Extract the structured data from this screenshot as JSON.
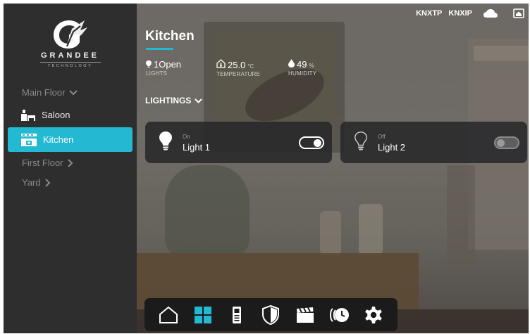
{
  "app": {
    "brand": "GRANDEE",
    "brand_sub": "TECHNOLOGY"
  },
  "topbar": {
    "knx_tp": "KNXTP",
    "knx_ip": "KNXIP",
    "icons": [
      "cloud-icon",
      "home-badge-icon"
    ]
  },
  "sidebar": {
    "main_floor": "Main Floor",
    "rooms": [
      {
        "label": "Saloon",
        "icon": "sofa-icon",
        "active": false
      },
      {
        "label": "Kitchen",
        "icon": "kitchen-icon",
        "active": true
      }
    ],
    "first_floor": "First Floor",
    "yard": "Yard"
  },
  "room": {
    "title": "Kitchen"
  },
  "stats": {
    "lights": {
      "value": "1Open",
      "label": "LIGHTS"
    },
    "temperature": {
      "value": "25.0",
      "unit": "°C",
      "label": "TEMPERATURE"
    },
    "humidity": {
      "value": "49",
      "unit": "%",
      "label": "HUMIDITY"
    }
  },
  "section": {
    "label": "LIGHTINGS"
  },
  "lights": [
    {
      "state": "On",
      "name": "Light 1",
      "on": true
    },
    {
      "state": "Off",
      "name": "Light 2",
      "on": false
    }
  ],
  "dock": {
    "items": [
      "home-icon",
      "grid-icon",
      "door-panel-icon",
      "shield-icon",
      "clapperboard-icon",
      "clock-icon",
      "gear-icon"
    ],
    "active": "grid-icon"
  },
  "colors": {
    "accent": "#23b9d3",
    "sidebar_bg": "#2e2e2e",
    "card_bg": "#28282a",
    "dock_bg": "#1b1b1b"
  }
}
